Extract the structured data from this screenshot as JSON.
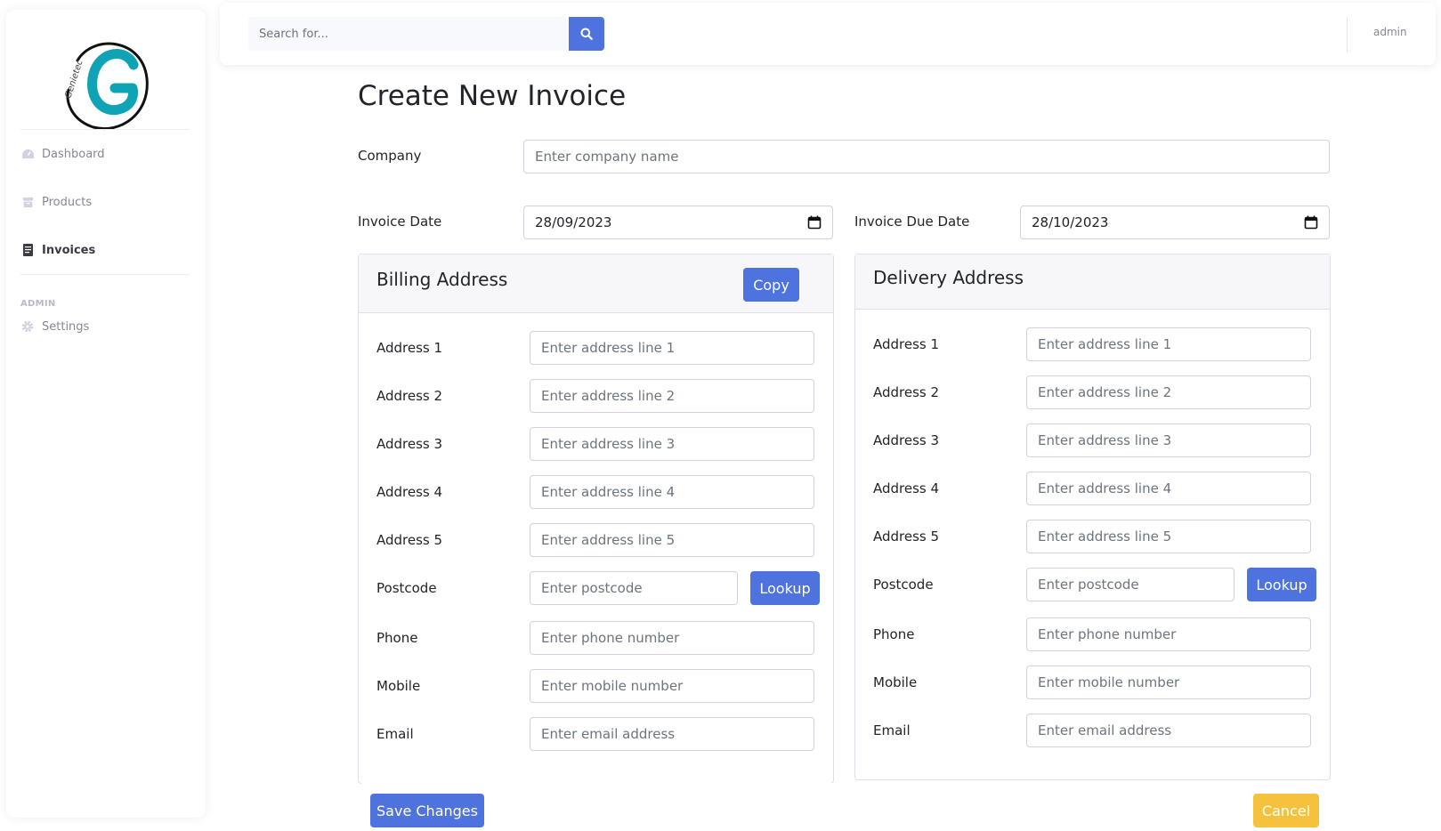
{
  "brand": {
    "logo_text": "Genietec",
    "logo_letter": "G",
    "accent": "#0fa3b5"
  },
  "sidebar": {
    "items": [
      {
        "label": "Dashboard",
        "icon": "dashboard-icon"
      },
      {
        "label": "Products",
        "icon": "box-icon"
      },
      {
        "label": "Invoices",
        "icon": "invoice-icon",
        "active": true
      }
    ],
    "admin_heading": "ADMIN",
    "admin_items": [
      {
        "label": "Settings",
        "icon": "gear-icon"
      }
    ]
  },
  "topbar": {
    "search_placeholder": "Search for...",
    "user": "admin"
  },
  "main": {
    "title": "Create New Invoice",
    "company_label": "Company",
    "company_placeholder": "Enter company name",
    "invoice_date_label": "Invoice Date",
    "invoice_date_value": "28/09/2023",
    "due_date_label": "Invoice Due Date",
    "due_date_value": "28/10/2023"
  },
  "billing": {
    "title": "Billing Address",
    "copy_label": "Copy",
    "fields": [
      {
        "label": "Address 1",
        "placeholder": "Enter address line 1"
      },
      {
        "label": "Address 2",
        "placeholder": "Enter address line 2"
      },
      {
        "label": "Address 3",
        "placeholder": "Enter address line 3"
      },
      {
        "label": "Address 4",
        "placeholder": "Enter address line 4"
      },
      {
        "label": "Address 5",
        "placeholder": "Enter address line 5"
      },
      {
        "label": "Postcode",
        "placeholder": "Enter postcode"
      },
      {
        "label": "Phone",
        "placeholder": "Enter phone number"
      },
      {
        "label": "Mobile",
        "placeholder": "Enter mobile number"
      },
      {
        "label": "Email",
        "placeholder": "Enter email address"
      }
    ],
    "lookup_label": "Lookup"
  },
  "delivery": {
    "title": "Delivery Address",
    "fields": [
      {
        "label": "Address 1",
        "placeholder": "Enter address line 1"
      },
      {
        "label": "Address 2",
        "placeholder": "Enter address line 2"
      },
      {
        "label": "Address 3",
        "placeholder": "Enter address line 3"
      },
      {
        "label": "Address 4",
        "placeholder": "Enter address line 4"
      },
      {
        "label": "Address 5",
        "placeholder": "Enter address line 5"
      },
      {
        "label": "Postcode",
        "placeholder": "Enter postcode"
      },
      {
        "label": "Phone",
        "placeholder": "Enter phone number"
      },
      {
        "label": "Mobile",
        "placeholder": "Enter mobile number"
      },
      {
        "label": "Email",
        "placeholder": "Enter email address"
      }
    ],
    "lookup_label": "Lookup"
  },
  "footer": {
    "save_label": "Save Changes",
    "cancel_label": "Cancel"
  },
  "colors": {
    "primary": "#4e73df",
    "warning": "#f6c23e",
    "sidebar_text": "#858796"
  }
}
